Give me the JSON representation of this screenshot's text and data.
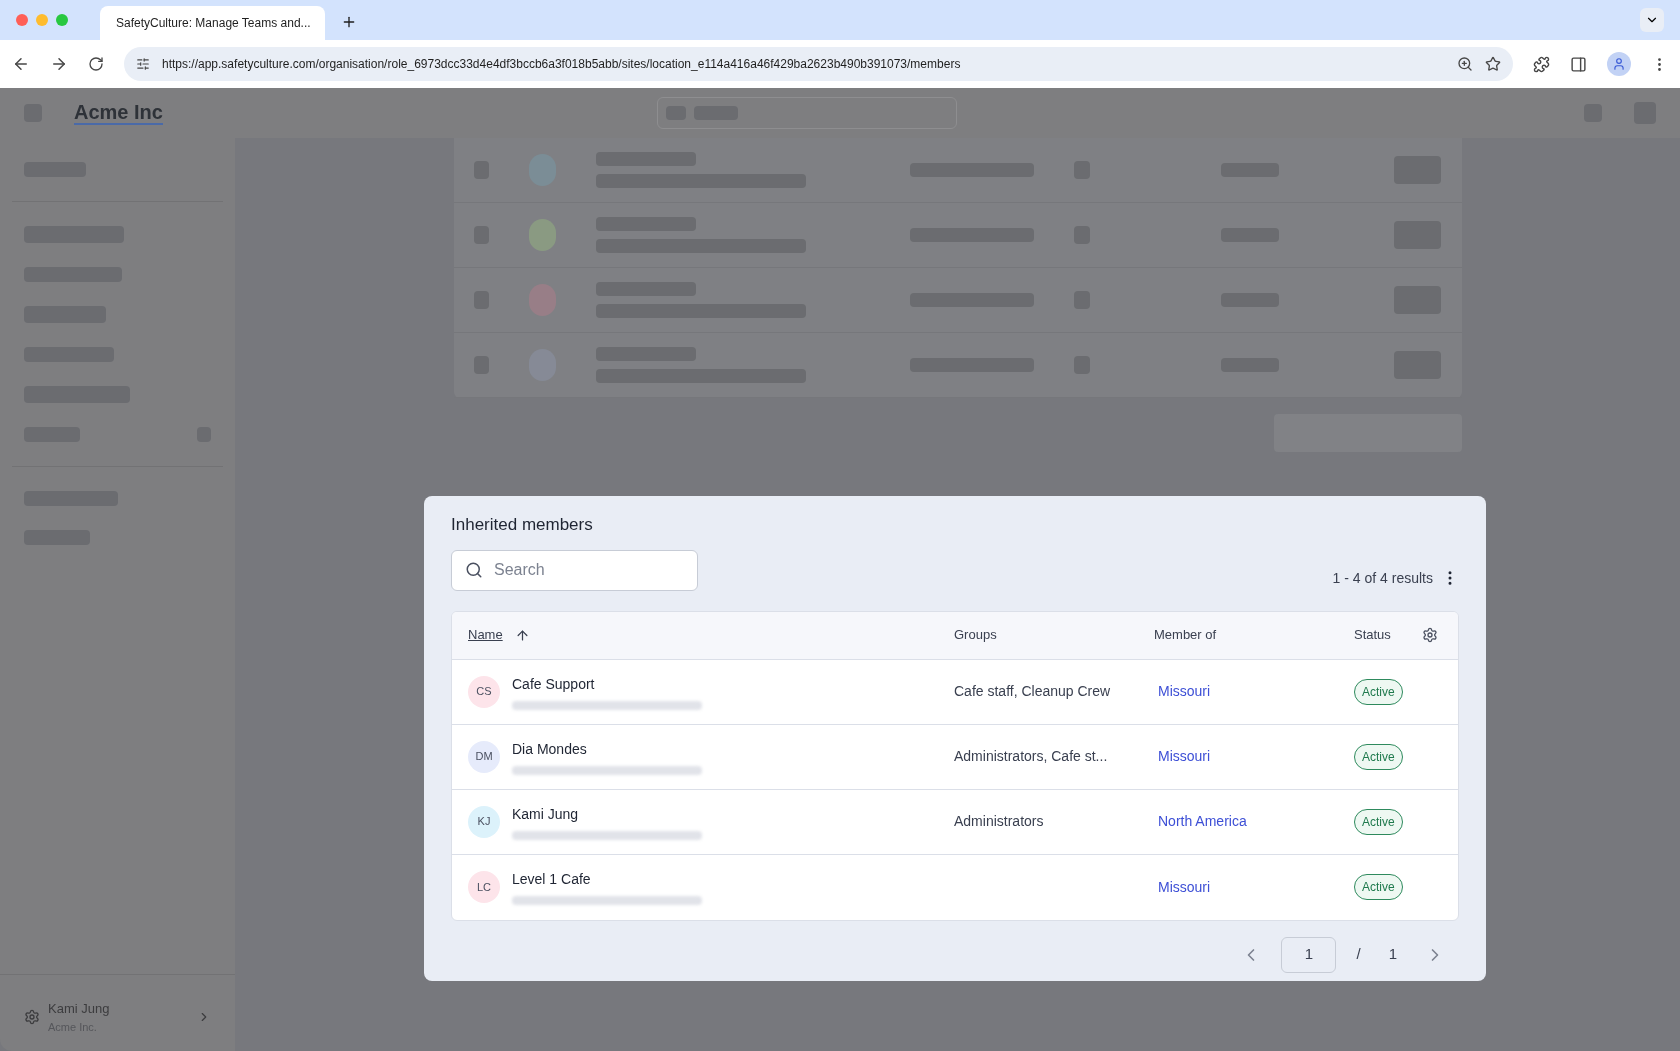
{
  "browser": {
    "tab_title": "SafetyCulture: Manage Teams and...",
    "url": "https://app.safetyculture.com/organisation/role_6973dcc33d4e4df3bccb6a3f018b5abb/sites/location_e114a416a46f429ba2623b490b391073/members"
  },
  "app": {
    "logo": "Acme Inc",
    "user": {
      "name": "Kami Jung",
      "org": "Acme Inc."
    }
  },
  "modal": {
    "title": "Inherited members",
    "search": {
      "placeholder": "Search"
    },
    "results": "1 - 4 of 4 results",
    "columns": [
      {
        "label": "Name",
        "sorted": true
      },
      {
        "label": "Groups",
        "sorted": false
      },
      {
        "label": "Member of",
        "sorted": false
      },
      {
        "label": "Status",
        "sorted": false
      }
    ],
    "rows": [
      {
        "initials": "CS",
        "color": "#fde4ea",
        "name": "Cafe Support",
        "groups": "Cafe staff, Cleanup Crew",
        "member_of": "Missouri",
        "status": "Active"
      },
      {
        "initials": "DM",
        "color": "#e6ebfb",
        "name": "Dia Mondes",
        "groups": "Administrators, Cafe st...",
        "member_of": "Missouri",
        "status": "Active"
      },
      {
        "initials": "KJ",
        "color": "#dcf2fb",
        "name": "Kami Jung",
        "groups": "Administrators",
        "member_of": "North America",
        "status": "Active"
      },
      {
        "initials": "LC",
        "color": "#fde4ea",
        "name": "Level 1 Cafe",
        "member_of": "Missouri",
        "status": "Active"
      }
    ],
    "pagination": {
      "page": "1",
      "separator": "/",
      "total": "1"
    }
  }
}
